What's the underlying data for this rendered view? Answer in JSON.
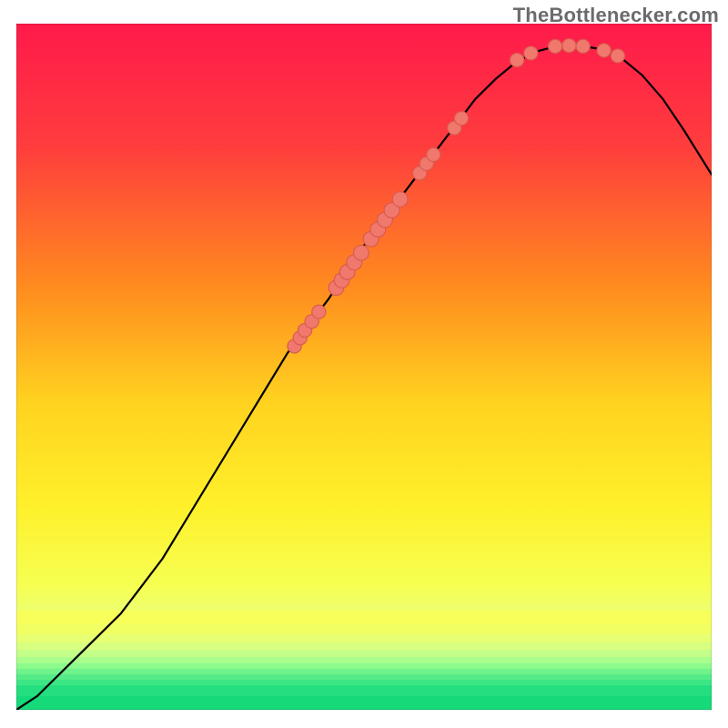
{
  "watermark": {
    "text": "TheBottlenecker.com"
  },
  "chart_data": {
    "type": "line",
    "title": "",
    "xlabel": "",
    "ylabel": "",
    "xlim": [
      0,
      100
    ],
    "ylim": [
      0,
      100
    ],
    "grid": false,
    "legend": false,
    "gradient_stops": [
      {
        "offset": 0.0,
        "color": "#ff1a4b"
      },
      {
        "offset": 0.18,
        "color": "#ff3d3d"
      },
      {
        "offset": 0.38,
        "color": "#ff8a1f"
      },
      {
        "offset": 0.55,
        "color": "#ffd21f"
      },
      {
        "offset": 0.7,
        "color": "#fff02a"
      },
      {
        "offset": 0.82,
        "color": "#f6ff52"
      },
      {
        "offset": 0.88,
        "color": "#e9ff82"
      },
      {
        "offset": 0.93,
        "color": "#b7ff8f"
      },
      {
        "offset": 0.965,
        "color": "#6cf78e"
      },
      {
        "offset": 1.0,
        "color": "#18e07a"
      }
    ],
    "bottom_bands": [
      {
        "y0": 85.5,
        "y1": 87.5,
        "color": "#f9ff5a"
      },
      {
        "y0": 87.5,
        "y1": 89.0,
        "color": "#f1ff62"
      },
      {
        "y0": 89.0,
        "y1": 90.2,
        "color": "#e7ff72"
      },
      {
        "y0": 90.2,
        "y1": 91.3,
        "color": "#d8ff80"
      },
      {
        "y0": 91.3,
        "y1": 92.3,
        "color": "#c3ff88"
      },
      {
        "y0": 92.3,
        "y1": 93.2,
        "color": "#aaff8c"
      },
      {
        "y0": 93.2,
        "y1": 94.0,
        "color": "#8dfb8c"
      },
      {
        "y0": 94.0,
        "y1": 94.8,
        "color": "#6ff38a"
      },
      {
        "y0": 94.8,
        "y1": 95.6,
        "color": "#55ec87"
      },
      {
        "y0": 95.6,
        "y1": 96.4,
        "color": "#3de684"
      },
      {
        "y0": 96.4,
        "y1": 98.0,
        "color": "#23df7f"
      },
      {
        "y0": 98.0,
        "y1": 100.0,
        "color": "#16da7a"
      }
    ],
    "curve": [
      {
        "x": 0,
        "y": 0
      },
      {
        "x": 3,
        "y": 2
      },
      {
        "x": 6,
        "y": 5
      },
      {
        "x": 9,
        "y": 8
      },
      {
        "x": 12,
        "y": 11
      },
      {
        "x": 15,
        "y": 14
      },
      {
        "x": 18,
        "y": 18
      },
      {
        "x": 21,
        "y": 22
      },
      {
        "x": 24,
        "y": 27
      },
      {
        "x": 27,
        "y": 32
      },
      {
        "x": 30,
        "y": 37
      },
      {
        "x": 33,
        "y": 42
      },
      {
        "x": 36,
        "y": 47
      },
      {
        "x": 39,
        "y": 52
      },
      {
        "x": 42,
        "y": 56
      },
      {
        "x": 45,
        "y": 60
      },
      {
        "x": 48,
        "y": 65
      },
      {
        "x": 51,
        "y": 69
      },
      {
        "x": 54,
        "y": 73
      },
      {
        "x": 57,
        "y": 77
      },
      {
        "x": 60,
        "y": 81
      },
      {
        "x": 63,
        "y": 85
      },
      {
        "x": 66,
        "y": 89
      },
      {
        "x": 69,
        "y": 92
      },
      {
        "x": 72,
        "y": 94.5
      },
      {
        "x": 75,
        "y": 96
      },
      {
        "x": 78,
        "y": 96.8
      },
      {
        "x": 81,
        "y": 96.8
      },
      {
        "x": 84,
        "y": 96.3
      },
      {
        "x": 87,
        "y": 95
      },
      {
        "x": 90,
        "y": 92.5
      },
      {
        "x": 93,
        "y": 89
      },
      {
        "x": 96,
        "y": 84.5
      },
      {
        "x": 100,
        "y": 78
      }
    ],
    "markers": [
      {
        "x": 40.0,
        "y": 53.0,
        "r": 1.0
      },
      {
        "x": 40.8,
        "y": 54.2,
        "r": 1.0
      },
      {
        "x": 41.5,
        "y": 55.3,
        "r": 1.0
      },
      {
        "x": 42.5,
        "y": 56.6,
        "r": 1.0
      },
      {
        "x": 43.5,
        "y": 58.0,
        "r": 1.0
      },
      {
        "x": 46.0,
        "y": 61.5,
        "r": 1.1
      },
      {
        "x": 46.8,
        "y": 62.6,
        "r": 1.1
      },
      {
        "x": 47.6,
        "y": 63.8,
        "r": 1.1
      },
      {
        "x": 48.6,
        "y": 65.2,
        "r": 1.1
      },
      {
        "x": 49.6,
        "y": 66.6,
        "r": 1.1
      },
      {
        "x": 51.0,
        "y": 68.6,
        "r": 1.1
      },
      {
        "x": 52.0,
        "y": 70.0,
        "r": 1.1
      },
      {
        "x": 53.0,
        "y": 71.4,
        "r": 1.1
      },
      {
        "x": 54.0,
        "y": 72.8,
        "r": 1.1
      },
      {
        "x": 55.2,
        "y": 74.4,
        "r": 1.1
      },
      {
        "x": 58.0,
        "y": 78.2,
        "r": 1.0
      },
      {
        "x": 59.0,
        "y": 79.6,
        "r": 1.0
      },
      {
        "x": 60.0,
        "y": 80.9,
        "r": 1.0
      },
      {
        "x": 63.0,
        "y": 84.8,
        "r": 1.0
      },
      {
        "x": 64.0,
        "y": 86.2,
        "r": 1.0
      },
      {
        "x": 72.0,
        "y": 94.7,
        "r": 1.0
      },
      {
        "x": 74.0,
        "y": 95.7,
        "r": 1.0
      },
      {
        "x": 77.5,
        "y": 96.7,
        "r": 1.0
      },
      {
        "x": 79.5,
        "y": 96.8,
        "r": 1.0
      },
      {
        "x": 81.5,
        "y": 96.7,
        "r": 1.0
      },
      {
        "x": 84.5,
        "y": 96.1,
        "r": 1.0
      },
      {
        "x": 86.5,
        "y": 95.3,
        "r": 1.0
      }
    ],
    "line_color": "#000000",
    "line_width": 2.2,
    "marker_color": "#f0786c",
    "marker_stroke": "#d85a50"
  }
}
